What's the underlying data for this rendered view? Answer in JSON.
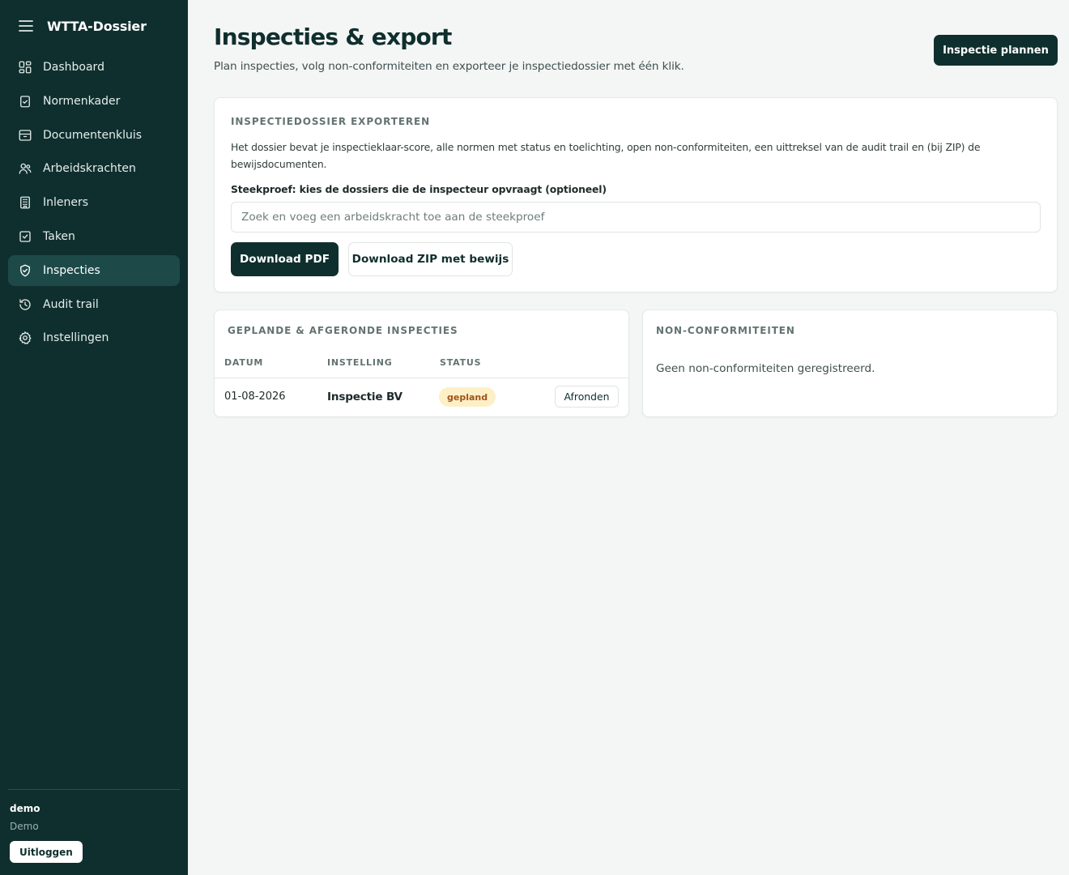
{
  "app": {
    "title": "WTTA-Dossier"
  },
  "icons": {
    "menu": "hamburger-menu-icon",
    "dashboard": "grid-icon",
    "normenkader": "clipboard-check-icon",
    "documentenkluis": "archive-icon",
    "arbeidskrachten": "users-icon",
    "inleners": "building-icon",
    "taken": "checkbox-icon",
    "inspecties": "shield-check-icon",
    "audit": "history-icon",
    "instellingen": "gear-icon"
  },
  "colors": {
    "sidebar_bg": "#0f2f2e",
    "sidebar_active": "#1d4a49",
    "primary": "#0f2f2e",
    "badge_bg": "#fdf0c6",
    "badge_text": "#a0521a"
  },
  "sidebar": {
    "items": [
      {
        "label": "Dashboard",
        "active": false
      },
      {
        "label": "Normenkader",
        "active": false
      },
      {
        "label": "Documentenkluis",
        "active": false
      },
      {
        "label": "Arbeidskrachten",
        "active": false
      },
      {
        "label": "Inleners",
        "active": false
      },
      {
        "label": "Taken",
        "active": false
      },
      {
        "label": "Inspecties",
        "active": true
      },
      {
        "label": "Audit trail",
        "active": false
      },
      {
        "label": "Instellingen",
        "active": false
      }
    ],
    "user": {
      "name": "demo",
      "org": "Demo"
    },
    "logout_label": "Uitloggen"
  },
  "header": {
    "title": "Inspecties & export",
    "subtitle": "Plan inspecties, volg non-conformiteiten en exporteer je inspectiedossier met één klik.",
    "plan_button": "Inspectie plannen"
  },
  "export": {
    "heading": "INSPECTIEDOSSIER EXPORTEREN",
    "description": "Het dossier bevat je inspectieklaar-score, alle normen met status en toelichting, open non-conformiteiten, een uittreksel van de audit trail en (bij ZIP) de bewijsdocumenten.",
    "sample_label": "Steekproef: kies de dossiers die de inspecteur opvraagt (optioneel)",
    "sample_placeholder": "Zoek en voeg een arbeidskracht toe aan de steekproef",
    "sample_value": "",
    "pdf_button": "Download PDF",
    "zip_button": "Download ZIP met bewijs"
  },
  "inspections": {
    "heading": "GEPLANDE & AFGERONDE INSPECTIES",
    "columns": {
      "date": "DATUM",
      "institution": "INSTELLING",
      "status": "STATUS"
    },
    "rows": [
      {
        "date": "01-08-2026",
        "institution": "Inspectie BV",
        "status": "gepland",
        "action": "Afronden"
      }
    ]
  },
  "nonconformities": {
    "heading": "NON-CONFORMITEITEN",
    "empty_text": "Geen non-conformiteiten geregistreerd."
  }
}
